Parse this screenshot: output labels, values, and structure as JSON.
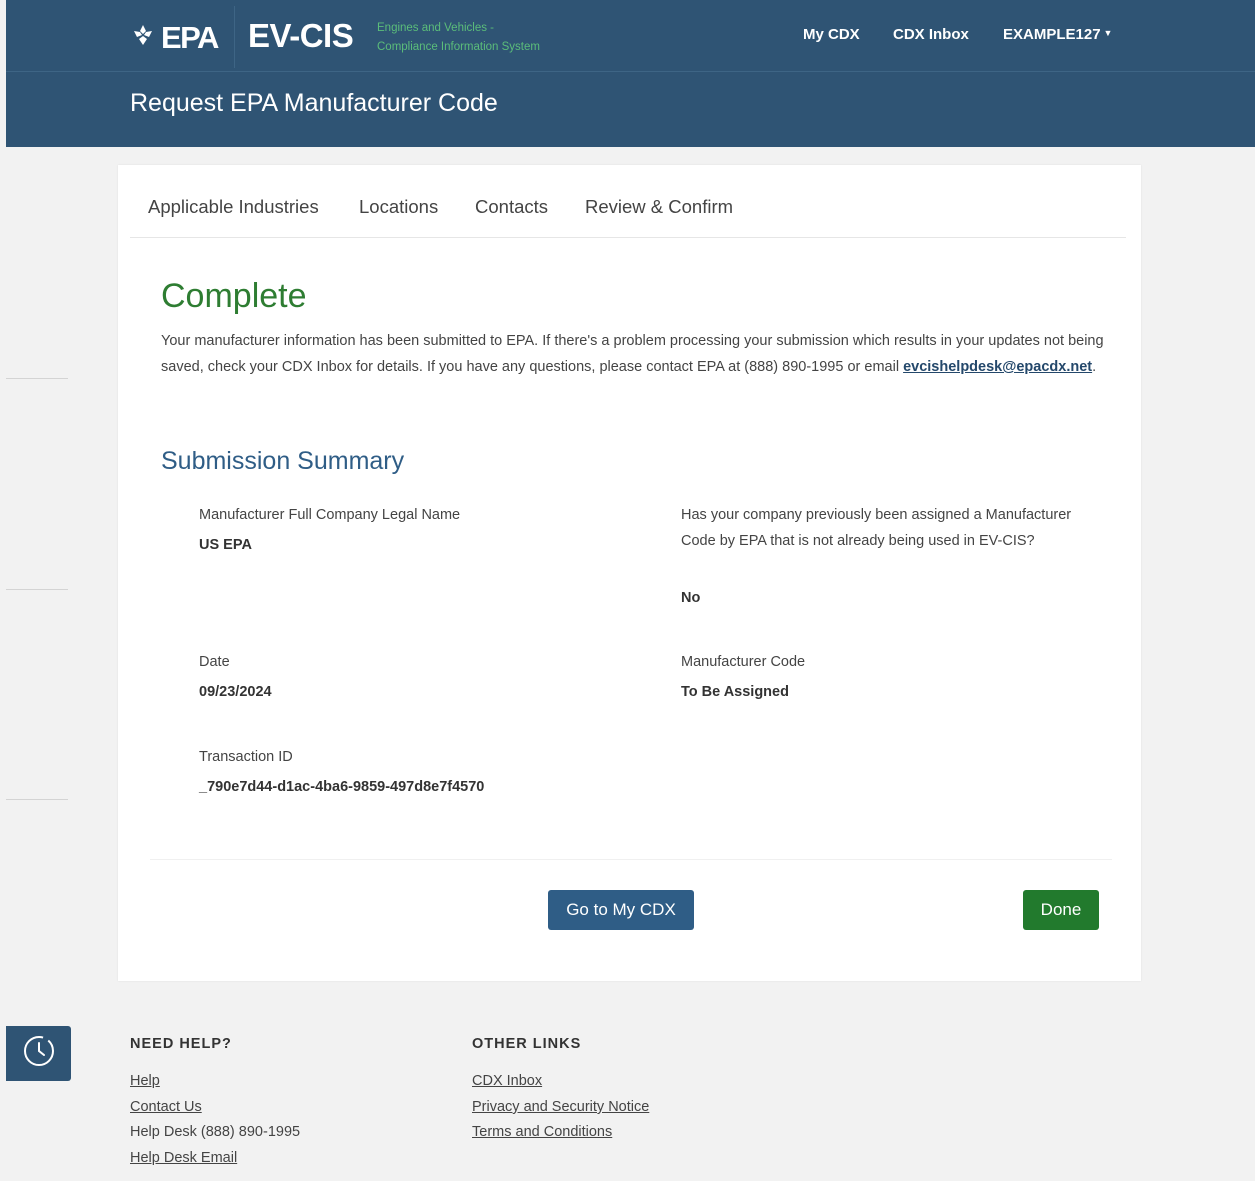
{
  "header": {
    "logo_epa": "EPA",
    "logo_app": "EV-CIS",
    "logo_sub_line1": "Engines and Vehicles -",
    "logo_sub_line2": "Compliance Information System",
    "nav_my_cdx": "My CDX",
    "nav_cdx_inbox": "CDX Inbox",
    "nav_user": "EXAMPLE127",
    "page_title": "Request EPA Manufacturer Code"
  },
  "tabs": [
    {
      "label": "Applicable Industries"
    },
    {
      "label": "Locations"
    },
    {
      "label": "Contacts"
    },
    {
      "label": "Review & Confirm"
    }
  ],
  "main": {
    "status_title": "Complete",
    "intro_text": "Your manufacturer information has been submitted to EPA. If there's a problem processing your submission which results in your updates not being saved, check your CDX Inbox for details. If you have any questions, please contact EPA at (888) 890-1995 or email ",
    "intro_email": "evcishelpdesk@epacdx.net",
    "intro_end": ".",
    "summary_title": "Submission Summary",
    "fields": {
      "company_name_label": "Manufacturer Full Company Legal Name",
      "company_name_value": "US EPA",
      "prev_assigned_label": "Has your company previously been assigned a Manufacturer Code by EPA that is not already being used in EV-CIS?",
      "prev_assigned_value": "No",
      "date_label": "Date",
      "date_value": "09/23/2024",
      "mfr_code_label": "Manufacturer Code",
      "mfr_code_value": "To Be Assigned",
      "transaction_label": "Transaction ID",
      "transaction_value": "_790e7d44-d1ac-4ba6-9859-497d8e7f4570"
    },
    "btn_go_cdx": "Go to My CDX",
    "btn_done": "Done"
  },
  "footer": {
    "need_help": "NEED HELP?",
    "other_links": "OTHER LINKS",
    "help": "Help",
    "contact_us": "Contact Us",
    "help_desk_phone": "Help Desk (888) 890-1995",
    "help_desk_email": "Help Desk Email",
    "cdx_inbox": "CDX Inbox",
    "privacy": "Privacy and Security Notice",
    "terms": "Terms and Conditions"
  },
  "icons": {
    "epa_logo": "epa-flower-icon",
    "clock": "clock-icon",
    "user_caret": "caret-down-icon"
  },
  "colors": {
    "header_bg": "#2f5474",
    "complete_green": "#2e7d32",
    "primary_blue": "#2f5d86",
    "done_green": "#227a2d"
  }
}
